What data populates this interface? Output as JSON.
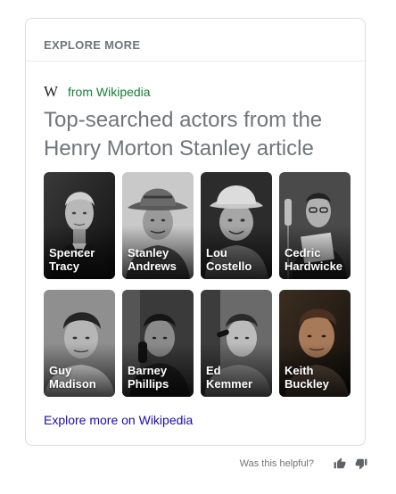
{
  "header": {
    "title": "EXPLORE MORE"
  },
  "source": {
    "logo": "W",
    "icon": "wikipedia-w-icon",
    "label": "from Wikipedia"
  },
  "headline": "Top-searched actors from the Henry Morton Stanley article",
  "actors": [
    {
      "first": "Spencer",
      "last": "Tracy"
    },
    {
      "first": "Stanley",
      "last": "Andrews"
    },
    {
      "first": "Lou",
      "last": "Costello"
    },
    {
      "first": "Cedric",
      "last": "Hardwicke"
    },
    {
      "first": "Guy",
      "last": "Madison"
    },
    {
      "first": "Barney",
      "last": "Phillips"
    },
    {
      "first": "Ed",
      "last": "Kemmer"
    },
    {
      "first": "Keith",
      "last": "Buckley"
    }
  ],
  "footer_link": "Explore more on Wikipedia",
  "feedback": {
    "question": "Was this helpful?",
    "up_icon": "thumbs-up-icon",
    "down_icon": "thumbs-down-icon"
  },
  "colors": {
    "source_green": "#188038",
    "link_blue": "#1a0dab",
    "muted_gray": "#70757a",
    "border": "#dadce0"
  }
}
